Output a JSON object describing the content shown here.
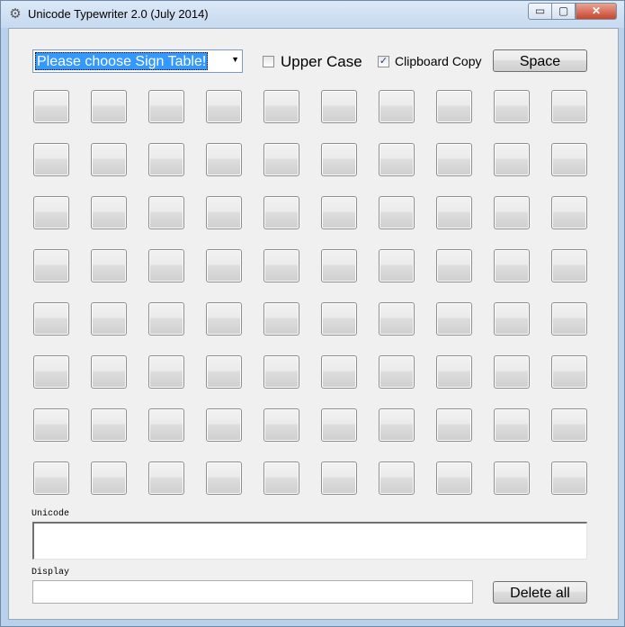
{
  "window": {
    "title": "Unicode Typewriter 2.0 (July 2014)",
    "controls": {
      "minimize": "▭",
      "maximize": "▢",
      "close": "✕"
    },
    "icon": "gear-icon"
  },
  "toolbar": {
    "sign_table": {
      "selected": "Please choose Sign Table!"
    },
    "upper_case": {
      "label": "Upper Case",
      "checked": false
    },
    "clipboard_copy": {
      "label": "Clipboard Copy",
      "checked": true,
      "mark": "✓"
    },
    "space_button": "Space"
  },
  "grid": {
    "rows": 8,
    "cols": 10,
    "buttons_label": ""
  },
  "unicode": {
    "label": "Unicode",
    "value": ""
  },
  "display": {
    "label": "Display",
    "value": ""
  },
  "delete_button": "Delete all",
  "colors": {
    "selection": "#3399ff",
    "window_frame": "#b9d1ea",
    "client": "#f0f0f0"
  }
}
